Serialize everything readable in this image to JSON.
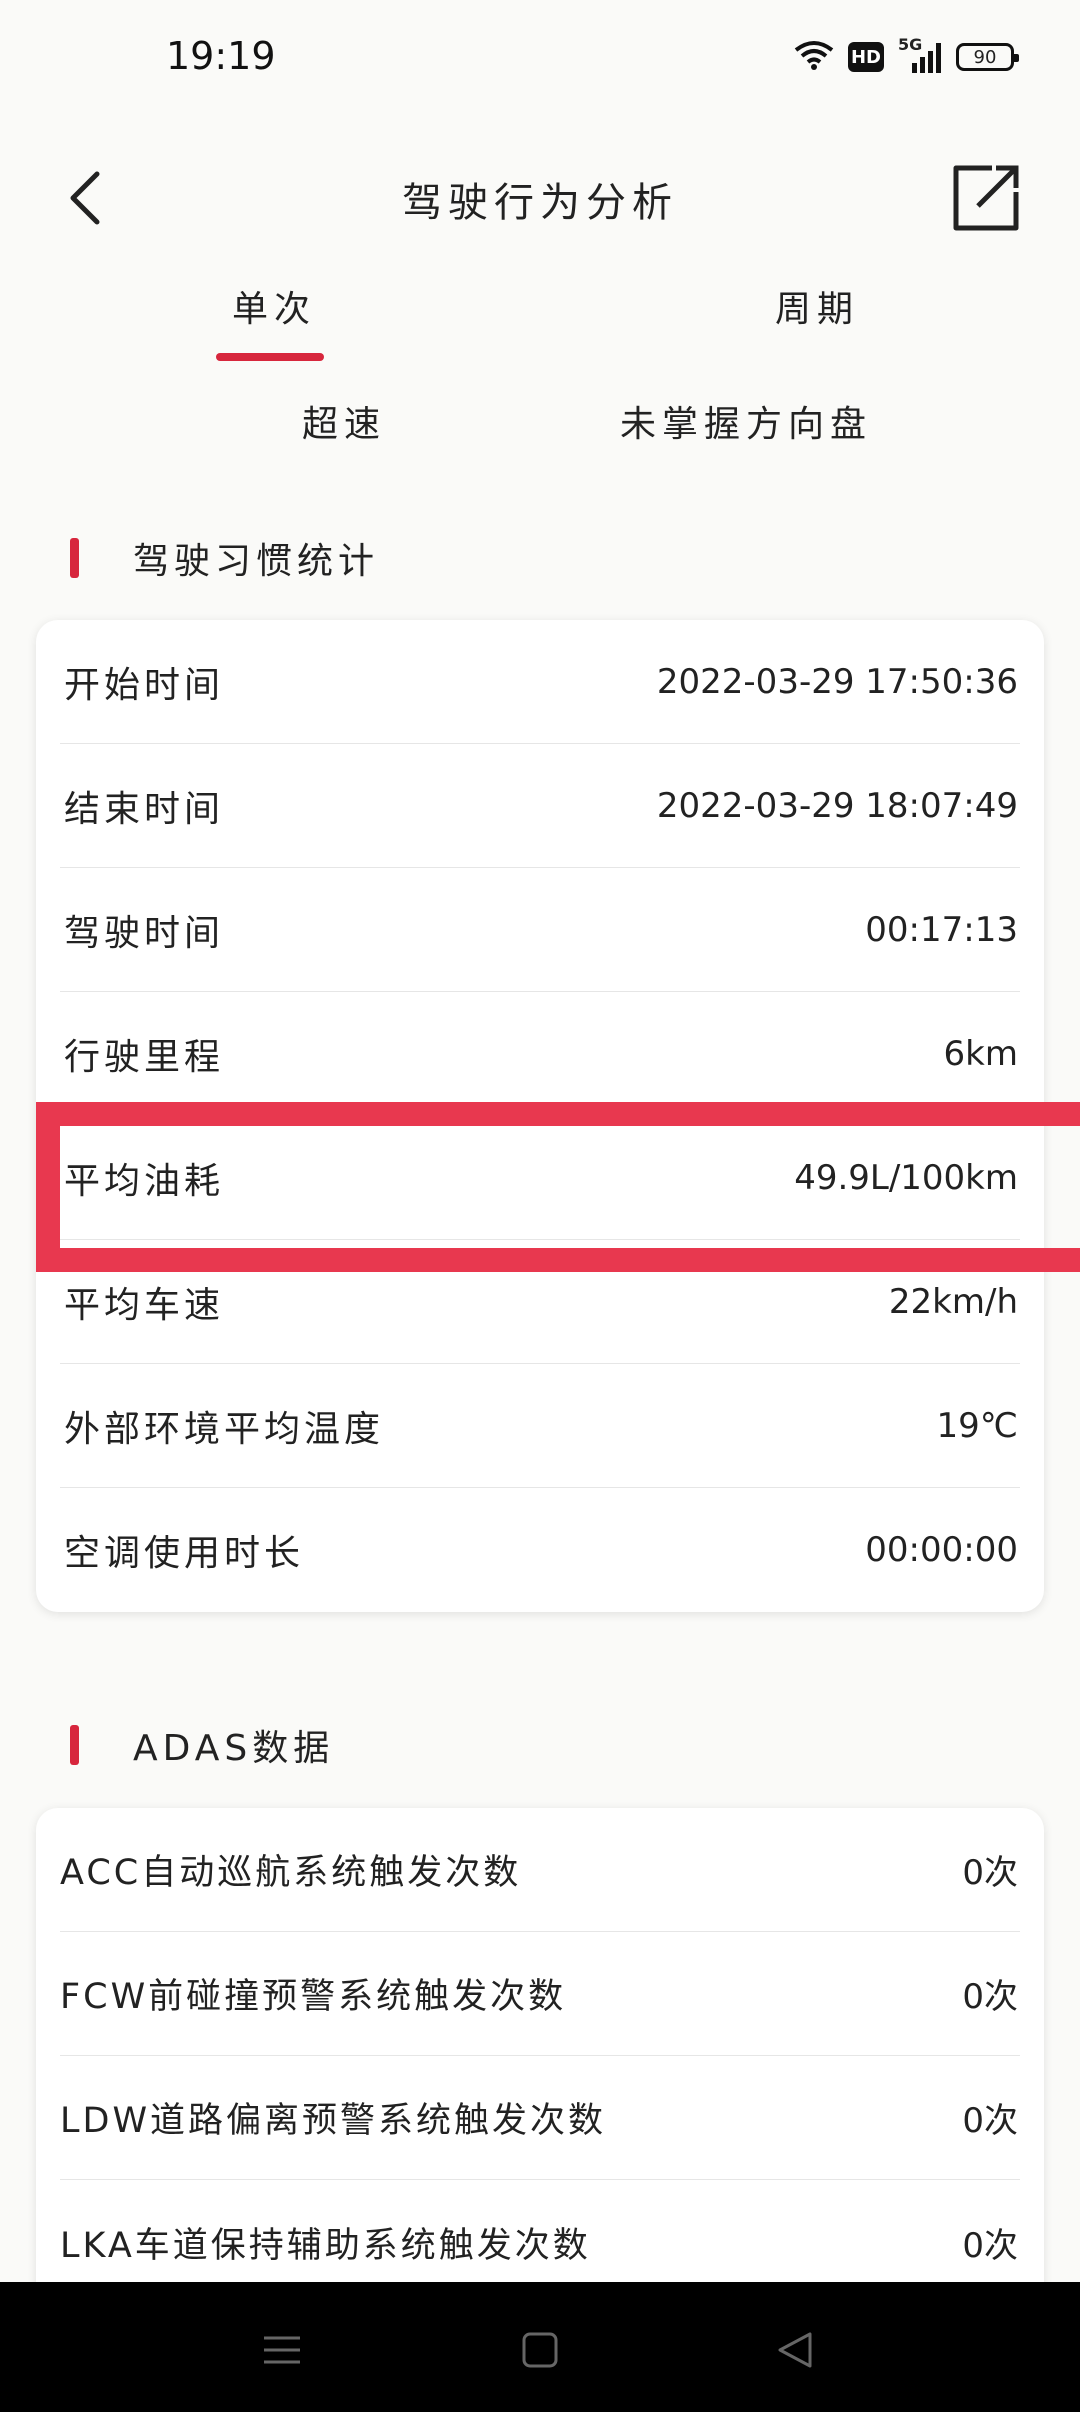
{
  "status_bar": {
    "time": "19:19",
    "hd": "HD",
    "network": "5G",
    "battery": "90"
  },
  "header": {
    "title": "驾驶行为分析"
  },
  "tabs": {
    "single": "单次",
    "period": "周期"
  },
  "subtabs": {
    "speeding": "超速",
    "no_wheel": "未掌握方向盘"
  },
  "habits": {
    "title": "驾驶习惯统计",
    "rows": [
      {
        "label": "开始时间",
        "value": "2022-03-29 17:50:36"
      },
      {
        "label": "结束时间",
        "value": "2022-03-29 18:07:49"
      },
      {
        "label": "驾驶时间",
        "value": "00:17:13"
      },
      {
        "label": "行驶里程",
        "value": "6km"
      },
      {
        "label": "平均油耗",
        "value": "49.9L/100km"
      },
      {
        "label": "平均车速",
        "value": "22km/h"
      },
      {
        "label": "外部环境平均温度",
        "value": "19℃"
      },
      {
        "label": "空调使用时长",
        "value": "00:00:00"
      }
    ]
  },
  "adas": {
    "title": "ADAS数据",
    "rows": [
      {
        "label": "ACC自动巡航系统触发次数",
        "value": "0次"
      },
      {
        "label": "FCW前碰撞预警系统触发次数",
        "value": "0次"
      },
      {
        "label": "LDW道路偏离预警系统触发次数",
        "value": "0次"
      },
      {
        "label": "LKA车道保持辅助系统触发次数",
        "value": "0次"
      }
    ]
  },
  "colors": {
    "accent": "#d7263d",
    "highlight": "#e8384f"
  }
}
